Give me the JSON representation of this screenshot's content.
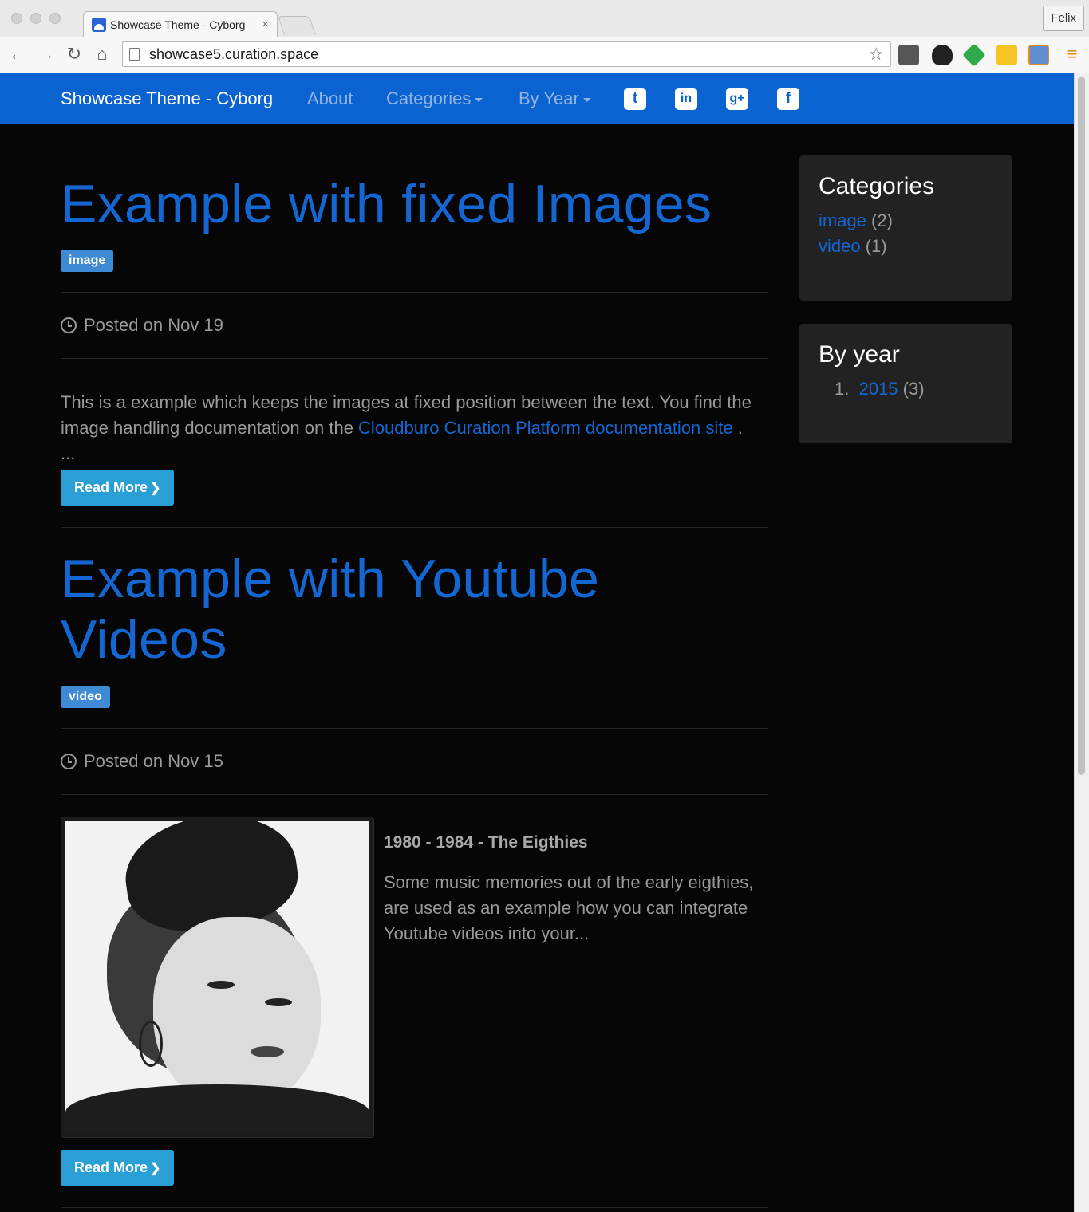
{
  "browser": {
    "tab_title": "Showcase Theme - Cyborg",
    "tab_close": "×",
    "profile_name": "Felix",
    "url": "showcase5.curation.space",
    "back": "←",
    "forward": "→",
    "reload": "↻",
    "home": "⌂",
    "bookmark_star": "☆",
    "menu": "≡"
  },
  "navbar": {
    "brand": "Showcase Theme - Cyborg",
    "about": "About",
    "categories": "Categories",
    "by_year": "By Year",
    "social": [
      "twitter-icon",
      "linkedin-icon",
      "google-plus-icon",
      "facebook-icon"
    ],
    "social_glyphs": {
      "twitter": "t",
      "linkedin": "in",
      "google_plus": "g+",
      "facebook": "f"
    }
  },
  "posts": [
    {
      "title": "Example with fixed Images",
      "tag": "image",
      "posted": "Posted on Nov 19",
      "excerpt_before": "This is a example which keeps the images at fixed position between the text. You find the image handling documentation on the ",
      "excerpt_link": "Cloudburo Curation Platform documentation site",
      "excerpt_after": " .",
      "ellipsis": "...",
      "read_more": "Read More"
    },
    {
      "title_line1": "Example with Youtube",
      "title_line2": "Videos",
      "tag": "video",
      "posted": "Posted on Nov 15",
      "side_heading": "1980 - 1984 - The Eigthies",
      "side_text": "Some music memories out of the early eigthies, are used as an example how you can integrate Youtube videos into your...",
      "read_more": "Read More"
    }
  ],
  "sidebar": {
    "categories_title": "Categories",
    "categories": [
      {
        "name": "image",
        "count": "(2)"
      },
      {
        "name": "video",
        "count": "(1)"
      }
    ],
    "byyear_title": "By year",
    "years": [
      {
        "index": "1.",
        "year": "2015",
        "count": "(3)"
      }
    ]
  },
  "colors": {
    "navbar": "#0b62d1",
    "link": "#1466d3",
    "button": "#2a9fd6",
    "badge": "#3f8bd3",
    "background": "#060606"
  }
}
